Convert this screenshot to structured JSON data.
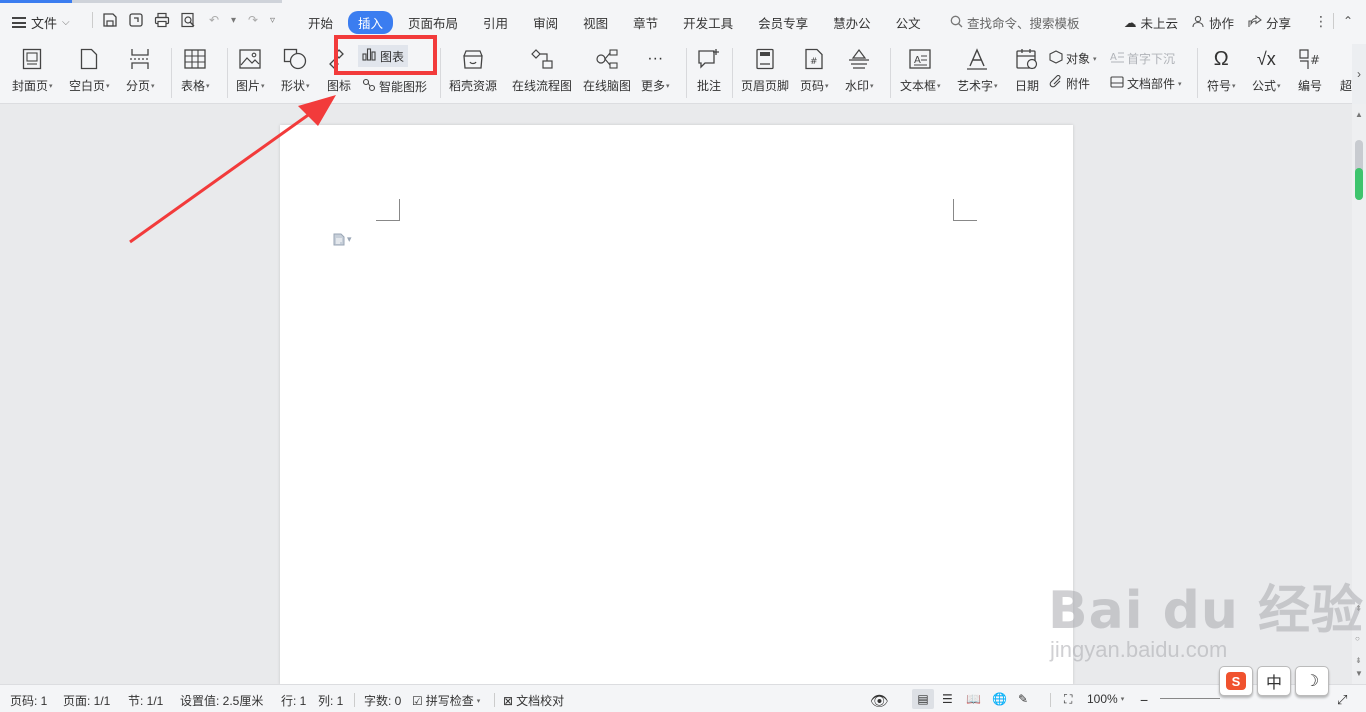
{
  "topbar": {
    "file_label": "文件",
    "tabs": [
      "开始",
      "插入",
      "页面布局",
      "引用",
      "审阅",
      "视图",
      "章节",
      "开发工具",
      "会员专享",
      "慧办公",
      "公文"
    ],
    "active_tab": "插入",
    "search_placeholder": "查找命令、搜索模板",
    "cloud_label": "未上云",
    "collab_label": "协作",
    "share_label": "分享"
  },
  "ribbon": {
    "cover_page": "封面页",
    "blank_page": "空白页",
    "page_break": "分页",
    "table": "表格",
    "picture": "图片",
    "shape": "形状",
    "icon": "图标",
    "chart": "图表",
    "smart_art": "智能图形",
    "daoke": "稻壳资源",
    "flowchart": "在线流程图",
    "mindmap": "在线脑图",
    "more": "更多",
    "comment": "批注",
    "header_footer": "页眉页脚",
    "page_number": "页码",
    "watermark": "水印",
    "textbox": "文本框",
    "wordart": "艺术字",
    "date": "日期",
    "object": "对象",
    "attachment": "附件",
    "drop_cap": "首字下沉",
    "doc_parts": "文档部件",
    "symbol": "符号",
    "formula": "公式",
    "numbering": "编号",
    "overflow": "超"
  },
  "status": {
    "page": "页码: 1",
    "pages": "页面: 1/1",
    "section": "节: 1/1",
    "setting": "设置值: 2.5厘米",
    "row": "行: 1",
    "col": "列: 1",
    "word_count": "字数: 0",
    "spell_check": "拼写检查",
    "proofread": "文档校对",
    "zoom": "100%"
  },
  "ime": {
    "logo": "S",
    "lang": "中"
  },
  "watermark": {
    "brand": "Bai du 经验",
    "url": "jingyan.baidu.com"
  },
  "colors": {
    "accent": "#3b7df0",
    "highlight": "#f23b3b",
    "scroll_green": "#3ec46d"
  }
}
